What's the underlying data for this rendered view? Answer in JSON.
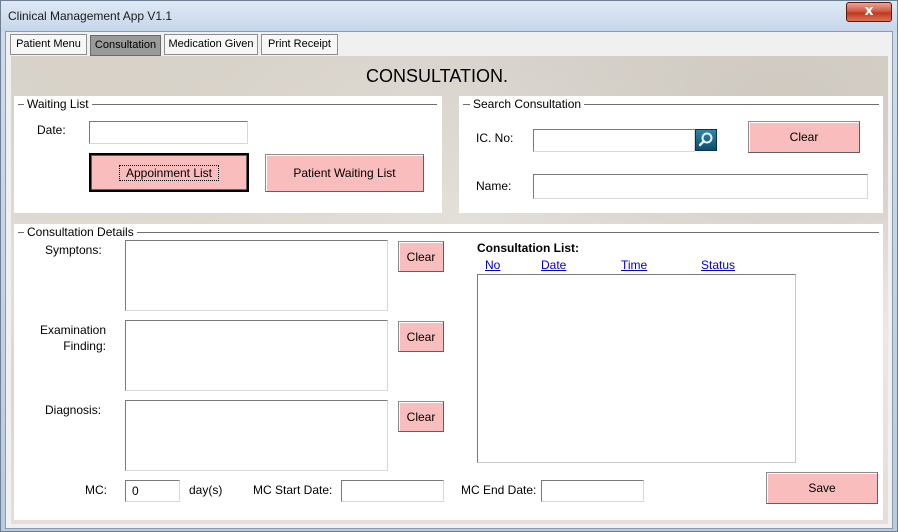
{
  "window": {
    "title": "Clinical Management App V1.1",
    "close_glyph": "x"
  },
  "tabs": [
    {
      "label": "Patient Menu",
      "active": false
    },
    {
      "label": "Consultation",
      "active": true
    },
    {
      "label": "Medication Given",
      "active": false
    },
    {
      "label": "Print Receipt",
      "active": false
    }
  ],
  "page": {
    "heading": "CONSULTATION."
  },
  "waiting_list": {
    "legend": "Waiting List",
    "date_label": "Date:",
    "date_value": "",
    "appointment_button": "Appoinment List",
    "patient_waiting_button": "Patient Waiting List"
  },
  "search": {
    "legend": "Search Consultation",
    "ic_label": "IC. No:",
    "ic_value": "",
    "search_icon": "magnifier-icon",
    "clear_label": "Clear",
    "name_label": "Name:",
    "name_value": ""
  },
  "details": {
    "legend": "Consultation Details",
    "symptoms_label": "Symptons:",
    "examination_label_1": "Examination",
    "examination_label_2": "Finding:",
    "diagnosis_label": "Diagnosis:",
    "clear_label": "Clear",
    "mc_label": "MC:",
    "mc_value": "0",
    "days_label": "day(s)",
    "mc_start_label": "MC Start Date:",
    "mc_start_value": "",
    "mc_end_label": "MC End Date:",
    "mc_end_value": "",
    "save_label": "Save"
  },
  "consultation_list": {
    "title": "Consultation List:",
    "columns": [
      "No",
      "Date",
      "Time",
      "Status"
    ]
  },
  "colors": {
    "button_pink": "#f9bdbd",
    "link_blue": "#0000cc",
    "search_teal": "#1a6a8c"
  }
}
